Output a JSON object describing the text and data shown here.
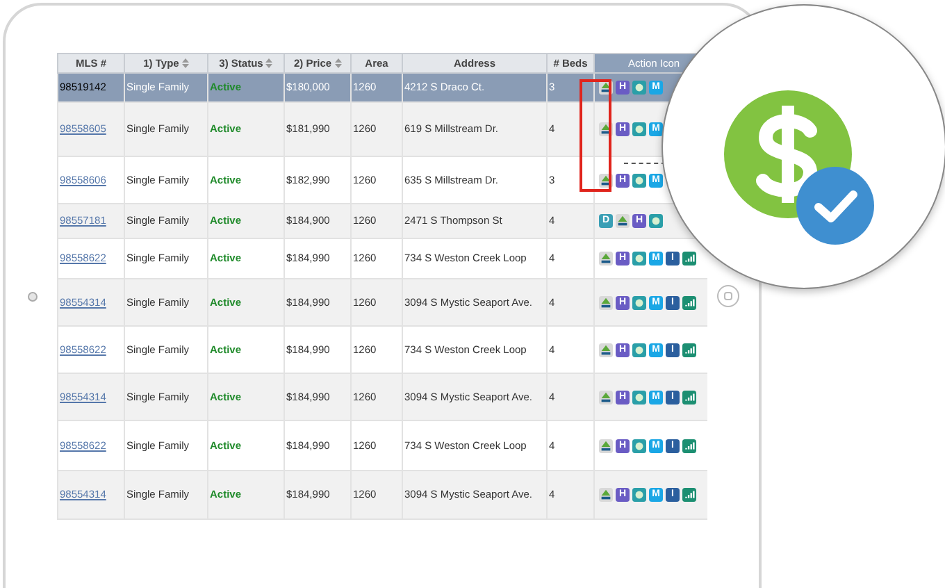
{
  "columns": [
    {
      "label": "MLS #",
      "sort": false
    },
    {
      "label": "1) Type",
      "sort": true
    },
    {
      "label": "3) Status",
      "sort": true
    },
    {
      "label": "2) Price",
      "sort": true
    },
    {
      "label": "Area",
      "sort": false
    },
    {
      "label": "Address",
      "sort": false
    },
    {
      "label": "# Beds",
      "sort": false
    },
    {
      "label": "Action Icon",
      "sort": false
    }
  ],
  "rows": [
    {
      "mls": "98519142",
      "selected": true,
      "type": "Single Family",
      "status": "Active",
      "price": "$180,000",
      "area": "1260",
      "address": "4212 S Draco Ct.",
      "beds": "3",
      "actions": [
        {
          "kind": "tree"
        },
        {
          "kind": "letter",
          "label": "H",
          "color": "#6a5cc4"
        },
        {
          "kind": "e",
          "color": "#2a9fa8"
        },
        {
          "kind": "letter",
          "label": "M",
          "color": "#1aa7e6"
        }
      ]
    },
    {
      "mls": "98558605",
      "selected": false,
      "type": "Single Family",
      "status": "Active",
      "price": "$181,990",
      "area": "1260",
      "address": "619 S Millstream Dr.",
      "beds": "4",
      "actions": [
        {
          "kind": "tree"
        },
        {
          "kind": "letter",
          "label": "H",
          "color": "#6a5cc4"
        },
        {
          "kind": "e",
          "color": "#2a9fa8"
        },
        {
          "kind": "letter",
          "label": "M",
          "color": "#1aa7e6"
        }
      ]
    },
    {
      "mls": "98558606",
      "selected": false,
      "type": "Single Family",
      "status": "Active",
      "price": "$182,990",
      "area": "1260",
      "address": "635 S Millstream Dr.",
      "beds": "3",
      "actions": [
        {
          "kind": "tree"
        },
        {
          "kind": "letter",
          "label": "H",
          "color": "#6a5cc4"
        },
        {
          "kind": "e",
          "color": "#2a9fa8"
        },
        {
          "kind": "letter",
          "label": "M",
          "color": "#1aa7e6"
        }
      ]
    },
    {
      "mls": "98557181",
      "selected": false,
      "type": "Single Family",
      "status": "Active",
      "price": "$184,900",
      "area": "1260",
      "address": "2471 S Thompson St",
      "beds": "4",
      "actions": [
        {
          "kind": "letter",
          "label": "D",
          "color": "#3a9fb5"
        },
        {
          "kind": "tree"
        },
        {
          "kind": "letter",
          "label": "H",
          "color": "#6a5cc4"
        },
        {
          "kind": "e",
          "color": "#2a9fa8"
        }
      ]
    },
    {
      "mls": "98558622",
      "selected": false,
      "type": "Single Family",
      "status": "Active",
      "price": "$184,990",
      "area": "1260",
      "address": "734 S Weston Creek Loop",
      "beds": "4",
      "actions": [
        {
          "kind": "tree"
        },
        {
          "kind": "letter",
          "label": "H",
          "color": "#6a5cc4"
        },
        {
          "kind": "e",
          "color": "#2a9fa8"
        },
        {
          "kind": "letter",
          "label": "M",
          "color": "#1aa7e6"
        },
        {
          "kind": "letter",
          "label": "I",
          "color": "#2b5f9e"
        },
        {
          "kind": "chart",
          "color": "#1c8f72"
        }
      ]
    },
    {
      "mls": "98554314",
      "selected": false,
      "type": "Single Family",
      "status": "Active",
      "price": "$184,990",
      "area": "1260",
      "address": "3094 S Mystic Seaport Ave.",
      "beds": "4",
      "actions": [
        {
          "kind": "tree"
        },
        {
          "kind": "letter",
          "label": "H",
          "color": "#6a5cc4"
        },
        {
          "kind": "e",
          "color": "#2a9fa8"
        },
        {
          "kind": "letter",
          "label": "M",
          "color": "#1aa7e6"
        },
        {
          "kind": "letter",
          "label": "I",
          "color": "#2b5f9e"
        },
        {
          "kind": "chart",
          "color": "#1c8f72"
        }
      ]
    },
    {
      "mls": "98558622",
      "selected": false,
      "type": "Single Family",
      "status": "Active",
      "price": "$184,990",
      "area": "1260",
      "address": "734 S Weston Creek Loop",
      "beds": "4",
      "actions": [
        {
          "kind": "tree"
        },
        {
          "kind": "letter",
          "label": "H",
          "color": "#6a5cc4"
        },
        {
          "kind": "e",
          "color": "#2a9fa8"
        },
        {
          "kind": "letter",
          "label": "M",
          "color": "#1aa7e6"
        },
        {
          "kind": "letter",
          "label": "I",
          "color": "#2b5f9e"
        },
        {
          "kind": "chart",
          "color": "#1c8f72"
        }
      ]
    },
    {
      "mls": "98554314",
      "selected": false,
      "type": "Single Family",
      "status": "Active",
      "price": "$184,990",
      "area": "1260",
      "address": "3094 S Mystic Seaport Ave.",
      "beds": "4",
      "actions": [
        {
          "kind": "tree"
        },
        {
          "kind": "letter",
          "label": "H",
          "color": "#6a5cc4"
        },
        {
          "kind": "e",
          "color": "#2a9fa8"
        },
        {
          "kind": "letter",
          "label": "M",
          "color": "#1aa7e6"
        },
        {
          "kind": "letter",
          "label": "I",
          "color": "#2b5f9e"
        },
        {
          "kind": "chart",
          "color": "#1c8f72"
        }
      ]
    },
    {
      "mls": "98558622",
      "selected": false,
      "type": "Single Family",
      "status": "Active",
      "price": "$184,990",
      "area": "1260",
      "address": "734 S Weston Creek Loop",
      "beds": "4",
      "actions": [
        {
          "kind": "tree"
        },
        {
          "kind": "letter",
          "label": "H",
          "color": "#6a5cc4"
        },
        {
          "kind": "e",
          "color": "#2a9fa8"
        },
        {
          "kind": "letter",
          "label": "M",
          "color": "#1aa7e6"
        },
        {
          "kind": "letter",
          "label": "I",
          "color": "#2b5f9e"
        },
        {
          "kind": "chart",
          "color": "#1c8f72"
        }
      ]
    },
    {
      "mls": "98554314",
      "selected": false,
      "type": "Single Family",
      "status": "Active",
      "price": "$184,990",
      "area": "1260",
      "address": "3094 S Mystic Seaport Ave.",
      "beds": "4",
      "actions": [
        {
          "kind": "tree"
        },
        {
          "kind": "letter",
          "label": "H",
          "color": "#6a5cc4"
        },
        {
          "kind": "e",
          "color": "#2a9fa8"
        },
        {
          "kind": "letter",
          "label": "M",
          "color": "#1aa7e6"
        },
        {
          "kind": "letter",
          "label": "I",
          "color": "#2b5f9e"
        },
        {
          "kind": "chart",
          "color": "#1c8f72"
        }
      ]
    }
  ]
}
